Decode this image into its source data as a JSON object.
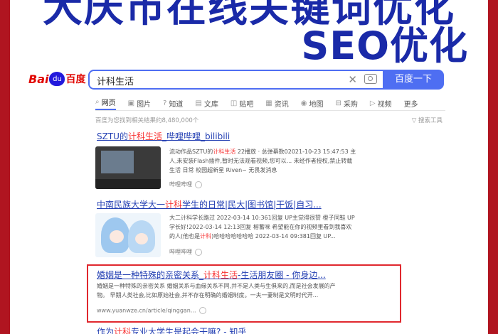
{
  "headline": {
    "top_text": "大庆市在线关键词优化",
    "main_text": "SEO优化"
  },
  "search": {
    "logo_bai": "Bai",
    "logo_du": "du",
    "logo_cn": "百度",
    "query": "计科生活",
    "button_label": "百度一下"
  },
  "tabs": [
    {
      "label": "网页",
      "icon": "search-icon"
    },
    {
      "label": "图片",
      "icon": "image-icon"
    },
    {
      "label": "知道",
      "icon": "question-icon"
    },
    {
      "label": "文库",
      "icon": "doc-icon"
    },
    {
      "label": "贴吧",
      "icon": "chat-icon"
    },
    {
      "label": "资讯",
      "icon": "news-icon"
    },
    {
      "label": "地图",
      "icon": "map-icon"
    },
    {
      "label": "采购",
      "icon": "cart-icon"
    },
    {
      "label": "视频",
      "icon": "video-icon"
    },
    {
      "label": "更多",
      "icon": ""
    }
  ],
  "result_count": "百度为您找到相关结果约8,480,000个",
  "search_tools": "搜索工具",
  "results": [
    {
      "title_pre": "SZTU的",
      "title_em": "计科生活",
      "title_post": "_哔哩哔哩_bilibili",
      "line1_pre": "流动作品SZTU的",
      "line1_em": "计科生活",
      "line1_post": " 22播放 · 总弹幕数02021-10-23 15:47:53 主",
      "line2": "人,未安装Flash插件,暂时无法观看视频,您可以... 未经作者授权,禁止转载",
      "line3": "生活 日常 校园超新星 Riven~ 无畏发消息",
      "source": "哔哩哔哩"
    },
    {
      "title_pre": "中南民族大学大一",
      "title_em": "计科",
      "title_post": "学生的日常|民大|图书馆|干饭|自习...",
      "line1": "大二计科学长路过 2022-03-14 10:361回复 UP主觉得很赞 橙子同鞋 UP",
      "line2": "学长好!2022-03-14 12:13回复 榕蓄咪 希望能在你的视频里看到我喜欢",
      "line3_pre": "的人(他也是",
      "line3_em": "计科",
      "line3_post": ")哈哈哈哈哈哈哈 2022-03-14 09:381回复 UP...",
      "source": "哔哩哔哩"
    },
    {
      "title_pre": "婚姻是一种特殊的亲密关系_",
      "title_em": "计科生活",
      "title_post": "-生活朋友圈 - 你身边...",
      "line1": "婚姻是一种特殊的亲密关系 婚姻关系与血缘关系不同,并不是人类与生俱来的,而是社会发展的产",
      "line2": "物。 早期人类社会,比如原始社会,并不存在明确的婚姻制度。一夫一妻制是文明时代开...",
      "source": "www.yuanwze.cn/article/qinggan..."
    },
    {
      "title_pre": "作为",
      "title_em": "计科",
      "title_post": "专业大学生是起会干嘛? - 知乎"
    }
  ]
}
